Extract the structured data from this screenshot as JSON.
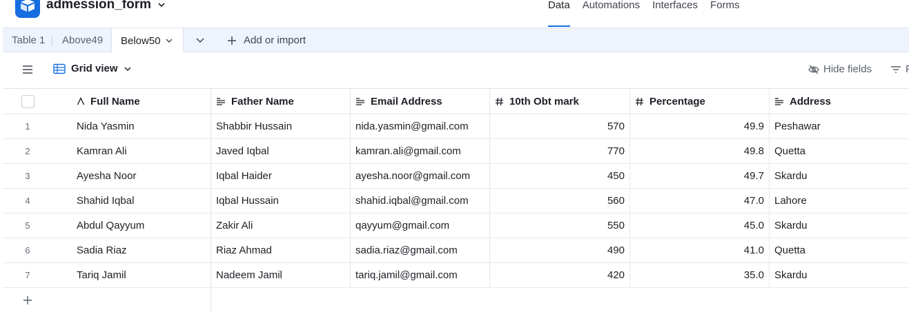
{
  "header": {
    "base_name": "admession_form",
    "nav": [
      "Data",
      "Automations",
      "Interfaces",
      "Forms"
    ],
    "active_nav": "Data",
    "brand_color": "#166ee1"
  },
  "tabs": {
    "items": [
      "Table 1",
      "Above49",
      "Below50"
    ],
    "active": "Below50",
    "add_label": "Add or import"
  },
  "viewbar": {
    "view_name": "Grid view",
    "hide_fields": "Hide fields",
    "filter_label": "F"
  },
  "grid": {
    "columns": [
      {
        "label": "Full Name",
        "icon": "text-a-icon"
      },
      {
        "label": "Father Name",
        "icon": "long-text-icon"
      },
      {
        "label": "Email Address",
        "icon": "long-text-icon"
      },
      {
        "label": "10th Obt mark",
        "icon": "number-hash-icon"
      },
      {
        "label": "Percentage",
        "icon": "number-hash-icon"
      },
      {
        "label": "Address",
        "icon": "long-text-icon"
      }
    ],
    "rows": [
      {
        "num": "1",
        "full_name": "Nida Yasmin",
        "father": "Shabbir Hussain",
        "email": "nida.yasmin@gmail.com",
        "marks": "570",
        "pct": "49.9",
        "address": "Peshawar"
      },
      {
        "num": "2",
        "full_name": "Kamran Ali",
        "father": "Javed Iqbal",
        "email": "kamran.ali@gmail.com",
        "marks": "770",
        "pct": "49.8",
        "address": "Quetta"
      },
      {
        "num": "3",
        "full_name": "Ayesha Noor",
        "father": "Iqbal Haider",
        "email": "ayesha.noor@gmail.com",
        "marks": "450",
        "pct": "49.7",
        "address": "Skardu"
      },
      {
        "num": "4",
        "full_name": "Shahid Iqbal",
        "father": "Iqbal Hussain",
        "email": "shahid.iqbal@gmail.com",
        "marks": "560",
        "pct": "47.0",
        "address": "Lahore"
      },
      {
        "num": "5",
        "full_name": "Abdul Qayyum",
        "father": "Zakir Ali",
        "email": "qayyum@gmail.com",
        "marks": "550",
        "pct": "45.0",
        "address": "Skardu"
      },
      {
        "num": "6",
        "full_name": "Sadia Riaz",
        "father": "Riaz Ahmad",
        "email": "sadia.riaz@gmail.com",
        "marks": "490",
        "pct": "41.0",
        "address": "Quetta"
      },
      {
        "num": "7",
        "full_name": "Tariq Jamil",
        "father": "Nadeem Jamil",
        "email": "tariq.jamil@gmail.com",
        "marks": "420",
        "pct": "35.0",
        "address": "Skardu"
      }
    ]
  }
}
